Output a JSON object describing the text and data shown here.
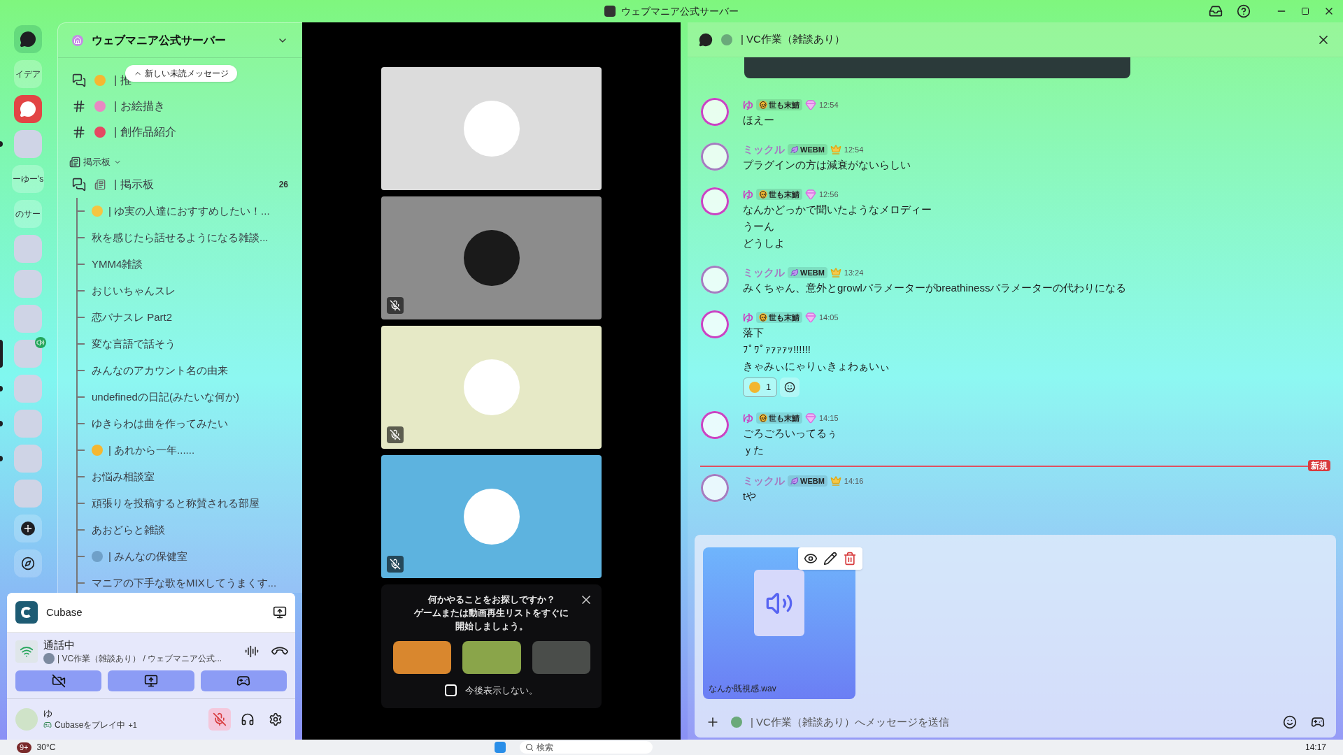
{
  "window": {
    "title": "ウェブマニア公式サーバー"
  },
  "servers": [
    {
      "kind": "home",
      "unread": false,
      "selected": false,
      "voice": false
    },
    {
      "kind": "text",
      "label": "イデア",
      "unread": false,
      "selected": false,
      "voice": false
    },
    {
      "kind": "app",
      "unread": false,
      "selected": false,
      "voice": false
    },
    {
      "kind": "image",
      "unread": true,
      "selected": false,
      "voice": false
    },
    {
      "kind": "text",
      "label": "ーゆー's",
      "unread": false,
      "selected": false,
      "voice": false
    },
    {
      "kind": "text",
      "label": "のサー",
      "unread": false,
      "selected": false,
      "voice": false
    },
    {
      "kind": "image",
      "unread": false,
      "selected": false,
      "voice": false
    },
    {
      "kind": "image",
      "unread": false,
      "selected": false,
      "voice": false
    },
    {
      "kind": "image",
      "unread": false,
      "selected": false,
      "voice": false
    },
    {
      "kind": "image",
      "unread": false,
      "selected": true,
      "voice": true
    },
    {
      "kind": "image",
      "unread": true,
      "selected": false,
      "voice": false
    },
    {
      "kind": "image",
      "unread": true,
      "selected": false,
      "voice": false
    },
    {
      "kind": "image",
      "unread": true,
      "selected": false,
      "voice": false
    },
    {
      "kind": "image",
      "unread": false,
      "selected": false,
      "voice": false
    },
    {
      "kind": "add",
      "unread": false,
      "selected": false,
      "voice": false
    },
    {
      "kind": "explore",
      "unread": false,
      "selected": false,
      "voice": false
    }
  ],
  "sidebar": {
    "server_name": "ウェブマニア公式サーバー",
    "unread_pill": "新しい未読メッセージ",
    "channels": [
      {
        "kind": "forum",
        "label": "| 推"
      },
      {
        "kind": "text",
        "label": "| お絵描き"
      },
      {
        "kind": "text",
        "label": "| 創作品紹介"
      }
    ],
    "category": {
      "label": "掲示板",
      "expanded": true
    },
    "forum": {
      "label": "| 掲示板",
      "count": "26"
    },
    "threads": [
      {
        "label": "| ゆ実の人達におすすめしたい！...",
        "emoji": true
      },
      {
        "label": "秋を感じたら話せるようになる雑談...",
        "emoji": false
      },
      {
        "label": "YMM4雑談",
        "emoji": false
      },
      {
        "label": "おじいちゃんスレ",
        "emoji": false
      },
      {
        "label": "恋バナスレ Part2",
        "emoji": false
      },
      {
        "label": "変な言語で話そう",
        "emoji": false
      },
      {
        "label": "みんなのアカウント名の由来",
        "emoji": false
      },
      {
        "label": "undefinedの日記(みたいな何か)",
        "emoji": false
      },
      {
        "label": "ゆきらわは曲を作ってみたい",
        "emoji": false
      },
      {
        "label": "| あれから一年......",
        "emoji": true
      },
      {
        "label": "お悩み相談室",
        "emoji": false
      },
      {
        "label": "頑張りを投稿すると称賛される部屋",
        "emoji": false
      },
      {
        "label": "あおどらと雑談",
        "emoji": false
      },
      {
        "label": "| みんなの保健室",
        "emoji": true
      },
      {
        "label": "マニアの下手な歌をMIXしてうまくす...",
        "emoji": false
      }
    ]
  },
  "activity": {
    "name": "Cubase"
  },
  "voice": {
    "status": "通話中",
    "channel": "| VC作業（雑談あり） / ウェブマニア公式..."
  },
  "user": {
    "name": "ゆ",
    "activity": "Cubaseをプレイ中",
    "extra": "+1",
    "muted": true
  },
  "tiles": [
    {
      "color": "#dcdcdc",
      "muted": false
    },
    {
      "color": "#8c8c8c",
      "muted": true
    },
    {
      "color": "#e6e9c6",
      "muted": true
    },
    {
      "color": "#5db3df",
      "muted": true
    }
  ],
  "popup": {
    "lines": [
      "何かやることをお探しですか？",
      "ゲームまたは動画再生リストをすぐに",
      "開始しましょう。"
    ],
    "checkbox": {
      "label": "今後表示しない。",
      "checked": false
    }
  },
  "chat": {
    "channel": "| VC作業（雑談あり）",
    "messages": [
      {
        "kind": "gem",
        "author": "ゆ",
        "color": "#c944c3",
        "role": "世も末鯖",
        "time": "12:54",
        "lines": [
          "ほえー"
        ],
        "new_before": false
      },
      {
        "kind": "crown",
        "author": "ミックル",
        "color": "#a57cc0",
        "role": "WEBM",
        "time": "12:54",
        "lines": [
          "プラグインの方は減衰がないらしい"
        ],
        "new_before": false
      },
      {
        "kind": "gem",
        "author": "ゆ",
        "color": "#c944c3",
        "role": "世も末鯖",
        "time": "12:56",
        "lines": [
          "なんかどっかで聞いたようなメロディー",
          "うーん",
          "どうしよ"
        ],
        "new_before": false
      },
      {
        "kind": "crown",
        "author": "ミックル",
        "color": "#a57cc0",
        "role": "WEBM",
        "time": "13:24",
        "lines": [
          "みくちゃん、意外とgrowlパラメーターがbreathinessパラメーターの代わりになる"
        ],
        "new_before": false
      },
      {
        "kind": "gem",
        "author": "ゆ",
        "color": "#c944c3",
        "role": "世も末鯖",
        "time": "14:05",
        "lines": [
          "落下",
          "ﾌﾟﾜﾟｧｧｧｧｯ!!!!!!",
          "きゃみぃにゃりぃきょわぁいぃ"
        ],
        "reactions": [
          {
            "count": "1"
          }
        ],
        "new_before": false
      },
      {
        "kind": "gem",
        "author": "ゆ",
        "color": "#c944c3",
        "role": "世も末鯖",
        "time": "14:15",
        "lines": [
          "ごろごろいってるぅ",
          "ｙた"
        ],
        "new_before": false
      },
      {
        "kind": "crown",
        "author": "ミックル",
        "color": "#a57cc0",
        "role": "WEBM",
        "time": "14:16",
        "lines": [
          "tや"
        ],
        "new_before": true
      }
    ],
    "new_label": "新規",
    "attachment": {
      "filename": "なんか既視感.wav"
    },
    "composer": {
      "placeholder": "| VC作業（雑談あり）へメッセージを送信"
    }
  },
  "taskbar": {
    "badge": "9+",
    "weather": "30°C",
    "search_placeholder": "検索",
    "time": "14:17"
  }
}
